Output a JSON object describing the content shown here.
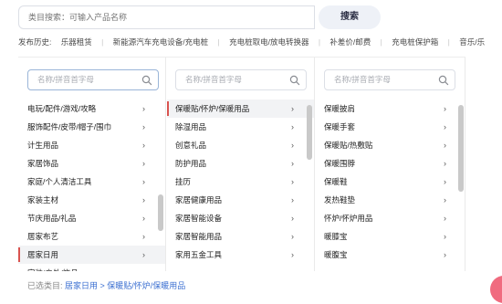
{
  "search": {
    "placeholder": "类目搜索：可输入产品名称",
    "button_label": "搜索"
  },
  "history": {
    "label": "发布历史:",
    "items": [
      "乐器租赁",
      "新能源汽车充电设备/充电桩",
      "充电桩取电/放电转换器",
      "补差价/邮费",
      "充电桩保护箱",
      "音乐/乐"
    ]
  },
  "columns": [
    {
      "placeholder": "名称/拼音首字母",
      "items": [
        {
          "label": "电玩/配件/游戏/攻略",
          "arrow": "›"
        },
        {
          "label": "服饰配件/皮带/帽子/围巾",
          "arrow": "›"
        },
        {
          "label": "计生用品",
          "arrow": "›"
        },
        {
          "label": "家居饰品",
          "arrow": "›"
        },
        {
          "label": "家庭/个人清洁工具",
          "arrow": "›"
        },
        {
          "label": "家装主材",
          "arrow": "›"
        },
        {
          "label": "节庆用品/礼品",
          "arrow": "›"
        },
        {
          "label": "居家布艺",
          "arrow": "›"
        },
        {
          "label": "居家日用",
          "arrow": "›",
          "active": true
        },
        {
          "label": "家装/户外/饰品",
          "arrow": "›"
        }
      ]
    },
    {
      "placeholder": "名称/拼音首字母",
      "items": [
        {
          "label": "保暖贴/怀炉/保暖用品",
          "arrow": "›",
          "active": true
        },
        {
          "label": "除湿用品",
          "arrow": "›"
        },
        {
          "label": "创意礼品",
          "arrow": "›"
        },
        {
          "label": "防护用品",
          "arrow": "›"
        },
        {
          "label": "挂历",
          "arrow": "›"
        },
        {
          "label": "家居健康用品",
          "arrow": "›"
        },
        {
          "label": "家居智能设备",
          "arrow": "›"
        },
        {
          "label": "家居智能用品",
          "arrow": "›"
        },
        {
          "label": "家用五金工具",
          "arrow": "›"
        }
      ]
    },
    {
      "placeholder": "名称/拼音首字母",
      "items": [
        {
          "label": "保暖披肩",
          "arrow": "›"
        },
        {
          "label": "保暖手套",
          "arrow": "›"
        },
        {
          "label": "保暖贴/热敷贴",
          "arrow": "›"
        },
        {
          "label": "保暖围脖",
          "arrow": "›"
        },
        {
          "label": "保暖鞋",
          "arrow": "›"
        },
        {
          "label": "发热鞋垫",
          "arrow": "›"
        },
        {
          "label": "怀炉/怀炉用品",
          "arrow": "›"
        },
        {
          "label": "暖膝宝",
          "arrow": "›"
        },
        {
          "label": "暖腹宝",
          "arrow": "›"
        }
      ]
    }
  ],
  "selected": {
    "label": "已选类目:",
    "path": "居家日用 > 保暖贴/怀炉/保暖用品"
  },
  "colors": {
    "active_marker": "#d9534f",
    "selected_path": "#3b6fd1",
    "float_button": "#f06b7f"
  }
}
